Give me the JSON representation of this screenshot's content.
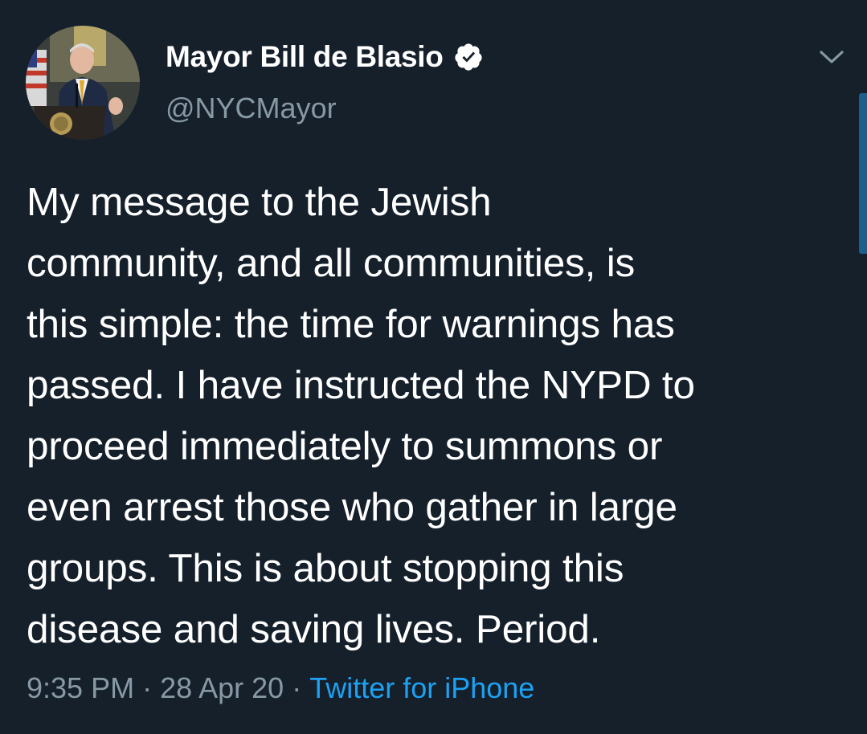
{
  "author": {
    "display_name": "Mayor Bill de Blasio",
    "handle": "@NYCMayor",
    "verified": true
  },
  "tweet": {
    "lines": [
      "My message to the Jewish",
      "community, and all communities, is",
      "this simple: the time for warnings has",
      "passed. I have instructed the NYPD to",
      "proceed immediately to summons or",
      "even arrest those who gather in large",
      "groups. This is about stopping this",
      "disease and saving lives. Period."
    ],
    "time": "9:35 PM",
    "date": "28 Apr 20",
    "separator": "·",
    "source": "Twitter for iPhone"
  },
  "icons": {
    "avatar": "profile-photo",
    "verified": "verified-badge-icon",
    "more": "chevron-down-icon"
  },
  "colors": {
    "background": "#15202b",
    "primary_text": "#ffffff",
    "secondary_text": "#8899a6",
    "link": "#1da1f2"
  }
}
